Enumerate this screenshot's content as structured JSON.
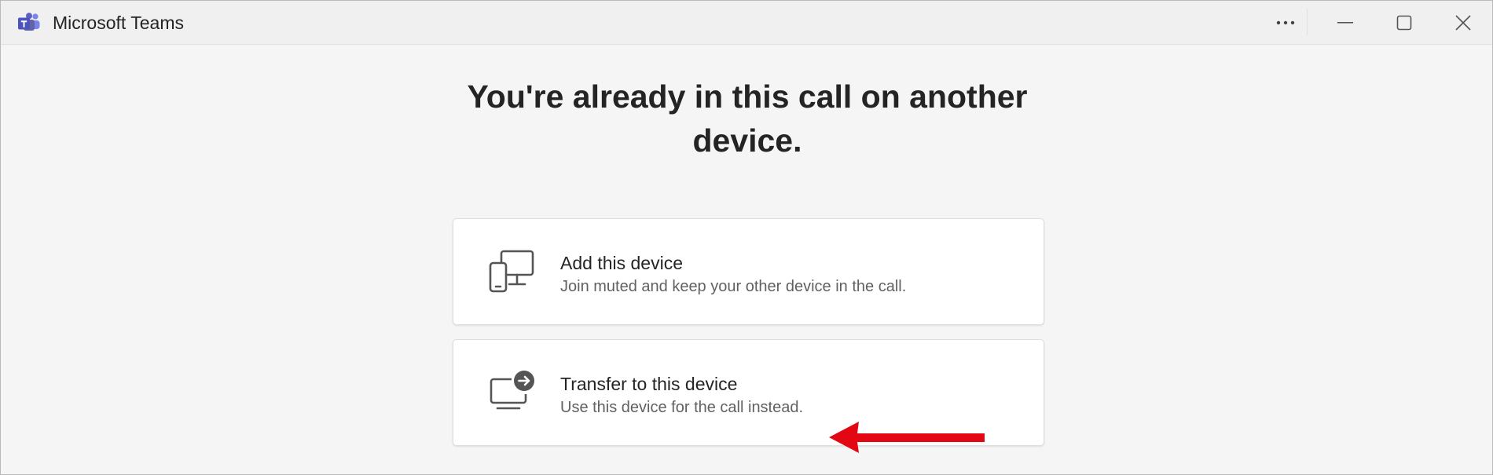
{
  "window": {
    "title": "Microsoft Teams"
  },
  "titlebar": {
    "more_icon": "more-horizontal-icon",
    "minimize_icon": "minimize-icon",
    "maximize_icon": "maximize-icon",
    "close_icon": "close-icon"
  },
  "main": {
    "heading": "You're already in this call on another device.",
    "options": [
      {
        "icon": "phone-and-desktop-icon",
        "title": "Add this device",
        "subtitle": "Join muted and keep your other device in the call."
      },
      {
        "icon": "desktop-transfer-icon",
        "title": "Transfer to this device",
        "subtitle": "Use this device for the call instead."
      }
    ]
  },
  "annotation": {
    "icon": "red-arrow-pointer",
    "color": "#e30613"
  },
  "colors": {
    "brand": "#5b5fc7",
    "text_primary": "#242424",
    "text_secondary": "#616161",
    "background": "#f5f5f5"
  }
}
